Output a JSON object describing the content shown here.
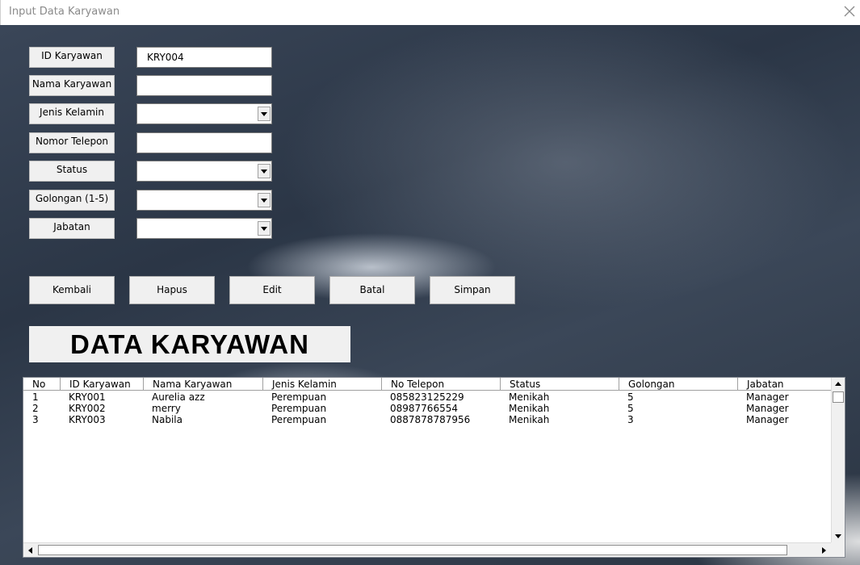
{
  "window": {
    "title": "Input Data Karyawan"
  },
  "form": {
    "fields": [
      {
        "label": "ID Karyawan",
        "value": "KRY004",
        "type": "text"
      },
      {
        "label": "Nama Karyawan",
        "value": "",
        "type": "text"
      },
      {
        "label": "Jenis Kelamin",
        "value": "",
        "type": "select"
      },
      {
        "label": "Nomor Telepon",
        "value": "",
        "type": "text"
      },
      {
        "label": "Status",
        "value": "",
        "type": "select"
      },
      {
        "label": "Golongan (1-5)",
        "value": "",
        "type": "select"
      },
      {
        "label": "Jabatan",
        "value": "",
        "type": "select"
      }
    ],
    "buttons": {
      "kembali": "Kembali",
      "hapus": "Hapus",
      "edit": "Edit",
      "batal": "Batal",
      "simpan": "Simpan"
    }
  },
  "section_heading": "DATA KARYAWAN",
  "table": {
    "columns": [
      "No",
      "ID Karyawan",
      "Nama Karyawan",
      "Jenis Kelamin",
      "No Telepon",
      "Status",
      "Golongan",
      "Jabatan"
    ],
    "rows": [
      [
        "1",
        "KRY001",
        "Aurelia azz",
        "Perempuan",
        "085823125229",
        "Menikah",
        "5",
        "Manager"
      ],
      [
        "2",
        "KRY002",
        "merry",
        "Perempuan",
        "08987766554",
        "Menikah",
        "5",
        "Manager"
      ],
      [
        "3",
        "KRY003",
        "Nabila",
        "Perempuan",
        "0887878787956",
        "Menikah",
        "3",
        "Manager"
      ]
    ]
  },
  "icons": {
    "close": "close-icon",
    "dropdown": "chevron-down-icon"
  },
  "colors": {
    "control_face": "#f0f0f0",
    "title_text": "#8a8a8a",
    "background_dark": "#2b3646"
  }
}
